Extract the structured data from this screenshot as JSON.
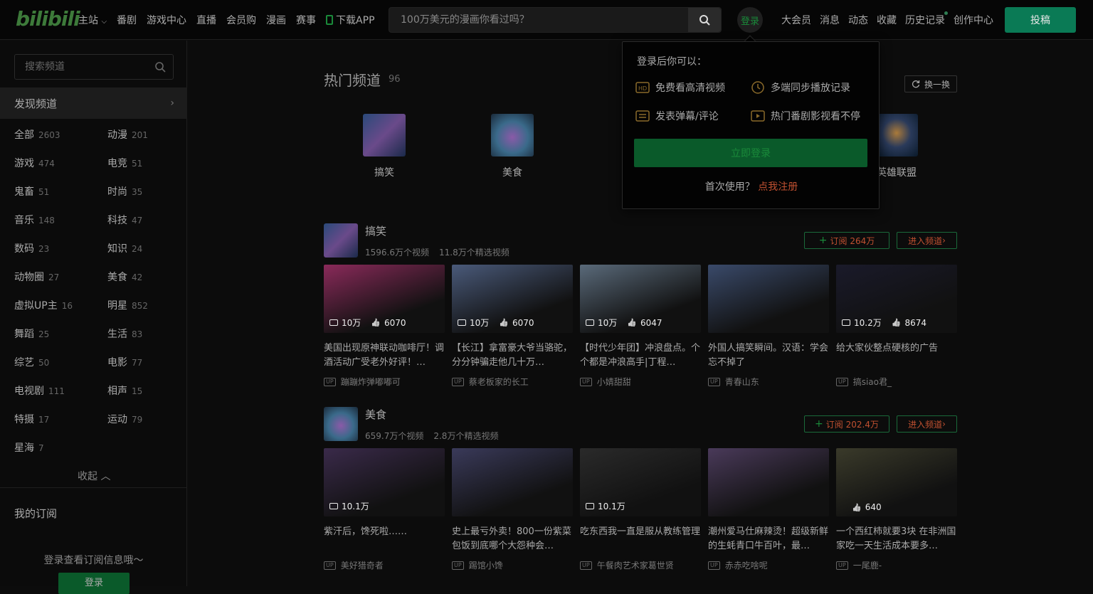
{
  "header": {
    "logo": "bilibili",
    "nav": [
      "主站",
      "番剧",
      "游戏中心",
      "直播",
      "会员购",
      "漫画",
      "赛事",
      "下载APP"
    ],
    "search_placeholder": "100万美元的漫画你看过吗？",
    "login": "登录",
    "right_nav": [
      "大会员",
      "消息",
      "动态",
      "收藏",
      "历史记录",
      "创作中心"
    ],
    "upload": "投稿"
  },
  "sidebar": {
    "search_placeholder": "搜索频道",
    "discover": "发现频道",
    "categories": [
      {
        "name": "全部",
        "count": "2603"
      },
      {
        "name": "动漫",
        "count": "201"
      },
      {
        "name": "游戏",
        "count": "474"
      },
      {
        "name": "电竞",
        "count": "51"
      },
      {
        "name": "鬼畜",
        "count": "51"
      },
      {
        "name": "时尚",
        "count": "35"
      },
      {
        "name": "音乐",
        "count": "148"
      },
      {
        "name": "科技",
        "count": "47"
      },
      {
        "name": "数码",
        "count": "23"
      },
      {
        "name": "知识",
        "count": "24"
      },
      {
        "name": "动物圈",
        "count": "27"
      },
      {
        "name": "美食",
        "count": "42"
      },
      {
        "name": "虚拟UP主",
        "count": "16"
      },
      {
        "name": "明星",
        "count": "852"
      },
      {
        "name": "舞蹈",
        "count": "25"
      },
      {
        "name": "生活",
        "count": "83"
      },
      {
        "name": "综艺",
        "count": "50"
      },
      {
        "name": "电影",
        "count": "77"
      },
      {
        "name": "电视剧",
        "count": "111"
      },
      {
        "name": "相声",
        "count": "15"
      },
      {
        "name": "特摄",
        "count": "17"
      },
      {
        "name": "运动",
        "count": "79"
      },
      {
        "name": "星海",
        "count": "7"
      }
    ],
    "collapse": "收起",
    "my_sub": "我的订阅",
    "login_tip": "登录查看订阅信息哦～",
    "login_btn": "登录"
  },
  "hot": {
    "title": "热门频道",
    "count": "96",
    "refresh": "换一换",
    "channels": [
      {
        "name": "搞笑",
        "color": "#3a3a60"
      },
      {
        "name": "美食",
        "color": "#4a5a70"
      },
      {
        "name": "英雄联盟",
        "color": "#20303a"
      }
    ]
  },
  "login_popup": {
    "title": "登录后你可以：",
    "features": [
      "免费看高清视频",
      "多端同步播放记录",
      "发表弹幕/评论",
      "热门番剧影视看不停"
    ],
    "button": "立即登录",
    "register_prefix": "首次使用？",
    "register_link": "点我注册"
  },
  "sections": [
    {
      "name": "搞笑",
      "videos_count": "1596.6万个视频",
      "featured_count": "11.8万个精选视频",
      "subscribe": "订阅 264万",
      "enter": "进入频道",
      "cards": [
        {
          "title": "美国出现原神联动咖啡厅！调酒活动广受老外好评！…",
          "author": "蹦蹦炸弹嘟嘟可",
          "views": "10万",
          "likes": "6070",
          "color": "#8a2a5a"
        },
        {
          "title": "【长江】拿富豪大爷当骆驼，分分钟骗走他几十万…",
          "author": "蔡老板家的长工",
          "views": "10万",
          "likes": "6070",
          "color": "#4a5a7a"
        },
        {
          "title": "【时代少年团】冲浪盘点。个个都是冲浪高手|丁程…",
          "author": "小婧甜甜",
          "views": "10万",
          "likes": "6047",
          "color": "#5a6a7a"
        },
        {
          "title": "外国人搞笑瞬间。汉语：学会忘不掉了",
          "author": "青春山东",
          "views": "",
          "likes": "",
          "color": "#3a4a6a"
        },
        {
          "title": "给大家伙整点硬核的广告",
          "author": "搞siao君_",
          "views": "10.2万",
          "likes": "8674",
          "color": "#1a1a2a"
        }
      ]
    },
    {
      "name": "美食",
      "videos_count": "659.7万个视频",
      "featured_count": "2.8万个精选视频",
      "subscribe": "订阅 202.4万",
      "enter": "进入频道",
      "cards": [
        {
          "title": "紫汗后，馋死啦……",
          "author": "美好猎奇者",
          "views": "10.1万",
          "likes": "",
          "color": "#3a2a4a"
        },
        {
          "title": "史上最亏外卖！800一份紫菜包饭到底哪个大怨种会…",
          "author": "踢馆小馋",
          "views": "",
          "likes": "",
          "color": "#3a3a5a"
        },
        {
          "title": "吃东西我一直是服从教练管理",
          "author": "午餐肉艺术家葛世贤",
          "views": "10.1万",
          "likes": "",
          "color": "#2a2a2a"
        },
        {
          "title": "潮州爱马仕麻辣烫！超级新鲜的生蚝青口牛百叶，最…",
          "author": "赤赤吃啥呢",
          "views": "",
          "likes": "",
          "color": "#4a3a5a"
        },
        {
          "title": "一个西红柿就要3块 在非洲国家吃一天生活成本要多…",
          "author": "一尾鹿-",
          "views": "",
          "likes": "640",
          "color": "#3a3a2a"
        }
      ]
    }
  ]
}
